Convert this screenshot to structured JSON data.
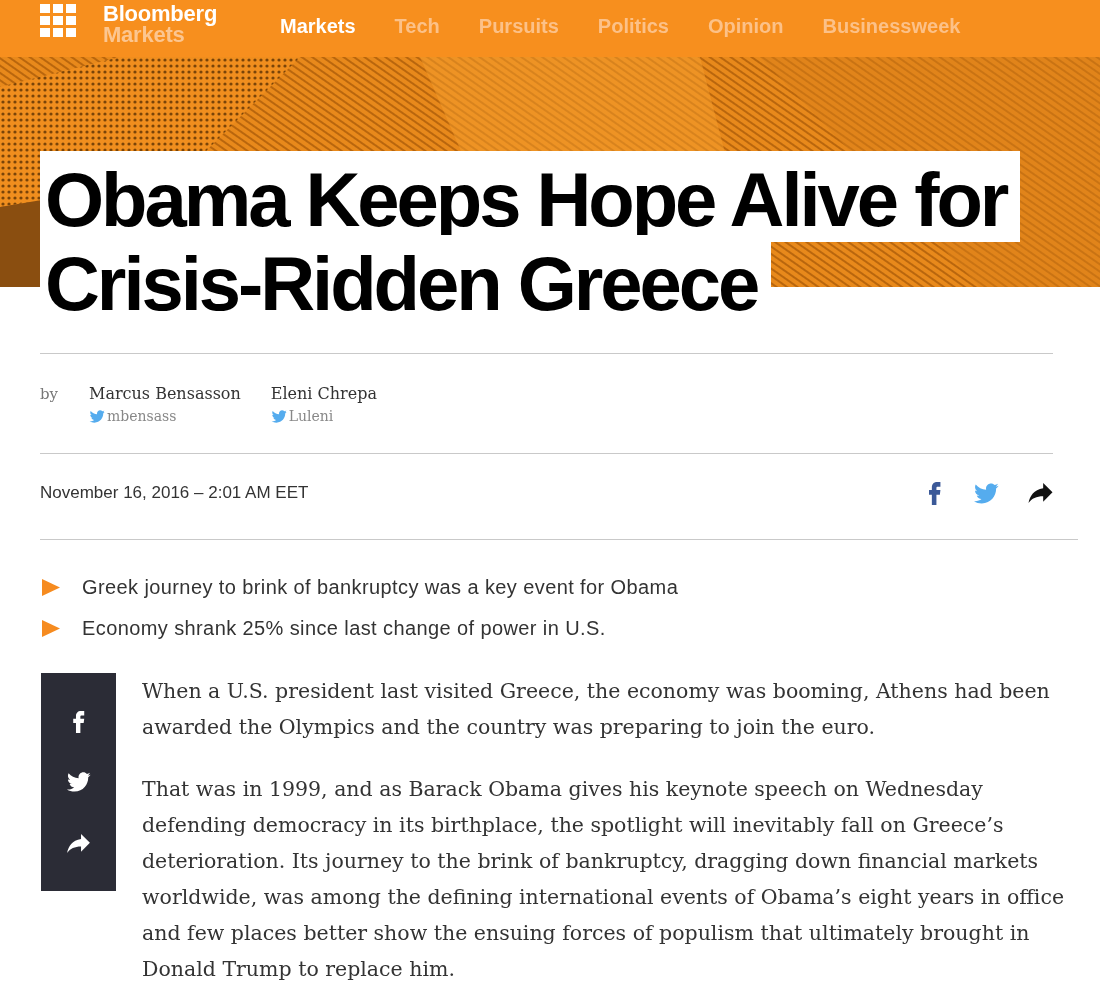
{
  "header": {
    "logo": {
      "brand": "Bloomberg",
      "section": "Markets"
    },
    "nav": [
      {
        "label": "Markets",
        "selected": true
      },
      {
        "label": "Tech",
        "selected": false
      },
      {
        "label": "Pursuits",
        "selected": false
      },
      {
        "label": "Politics",
        "selected": false
      },
      {
        "label": "Opinion",
        "selected": false
      },
      {
        "label": "Businessweek",
        "selected": false
      }
    ]
  },
  "article": {
    "headline": "Obama Keeps Hope Alive for Crisis-Ridden Greece",
    "byline": {
      "prefix": "by",
      "authors": [
        {
          "name": "Marcus Bensasson",
          "twitter": "mbensass"
        },
        {
          "name": "Eleni Chrepa",
          "twitter": "Luleni"
        }
      ]
    },
    "timestamp": "November 16, 2016 – 2:01 AM EET",
    "bullets": [
      "Greek journey to brink of bankruptcy was a key event for Obama",
      "Economy shrank 25% since last change of power in U.S."
    ],
    "paragraphs": [
      "When a U.S. president last visited Greece, the economy was booming, Athens had been awarded the Olympics and the country was preparing to join the euro.",
      "That was in 1999, and as Barack Obama gives his keynote speech on Wednesday defending democracy in its birthplace, the spotlight will inevitably fall on Greece’s deterioration. Its journey to the brink of bankruptcy, dragging down financial markets worldwide, was among the defining international events of Obama’s eight years in office and few places better show the ensuing forces of populism that ultimately brought in Donald Trump to replace him."
    ]
  }
}
